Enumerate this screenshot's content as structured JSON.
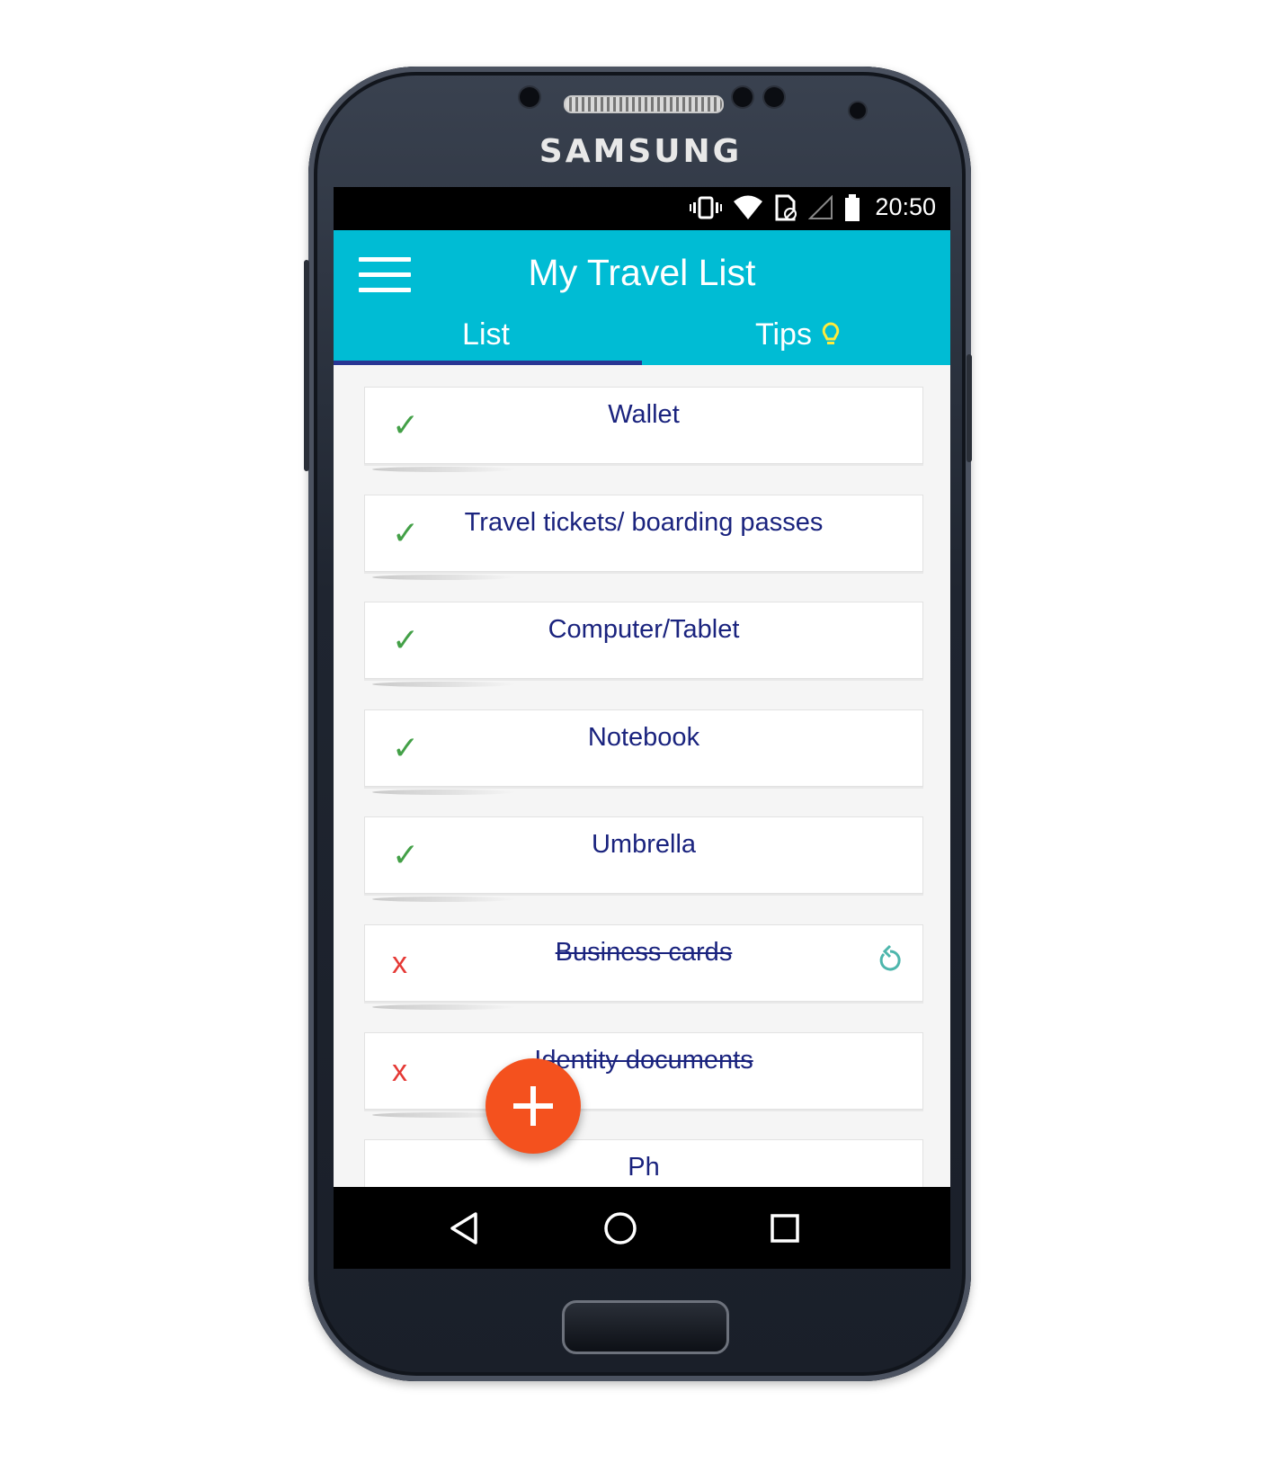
{
  "device": {
    "brand": "SAMSUNG"
  },
  "status_bar": {
    "time": "20:50",
    "icons": [
      "vibrate-icon",
      "wifi-icon",
      "sim-card-icon",
      "signal-icon",
      "battery-icon"
    ]
  },
  "app_bar": {
    "title": "My Travel List",
    "menu_icon": "hamburger-menu-icon",
    "tabs": [
      {
        "label": "List",
        "selected": true
      },
      {
        "label": "Tips",
        "selected": false,
        "icon": "lightbulb-icon"
      }
    ]
  },
  "list": {
    "items": [
      {
        "label": "Wallet",
        "status": "checked",
        "mark": "✓"
      },
      {
        "label": "Travel tickets/ boarding passes",
        "status": "checked",
        "mark": "✓"
      },
      {
        "label": "Computer/Tablet",
        "status": "checked",
        "mark": "✓"
      },
      {
        "label": "Notebook",
        "status": "checked",
        "mark": "✓"
      },
      {
        "label": "Umbrella",
        "status": "checked",
        "mark": "✓"
      },
      {
        "label": "Business cards",
        "status": "crossed",
        "mark": "x",
        "undo_icon": "undo-icon"
      },
      {
        "label": "Identity documents",
        "status": "crossed",
        "mark": "x"
      },
      {
        "label": "Ph",
        "status": "partially-visible",
        "mark": ""
      }
    ]
  },
  "fab": {
    "icon": "plus-icon"
  },
  "nav_bar": {
    "icons": [
      "back-icon",
      "home-icon",
      "recents-icon"
    ]
  },
  "colors": {
    "accent": "#00bcd4",
    "tab_indicator": "#283593",
    "item_text": "#1a237e",
    "check": "#43a047",
    "cross": "#e53935",
    "fab": "#f4511e",
    "tips_bulb": "#ffeb3b",
    "content_bg": "#f5f5f5"
  }
}
